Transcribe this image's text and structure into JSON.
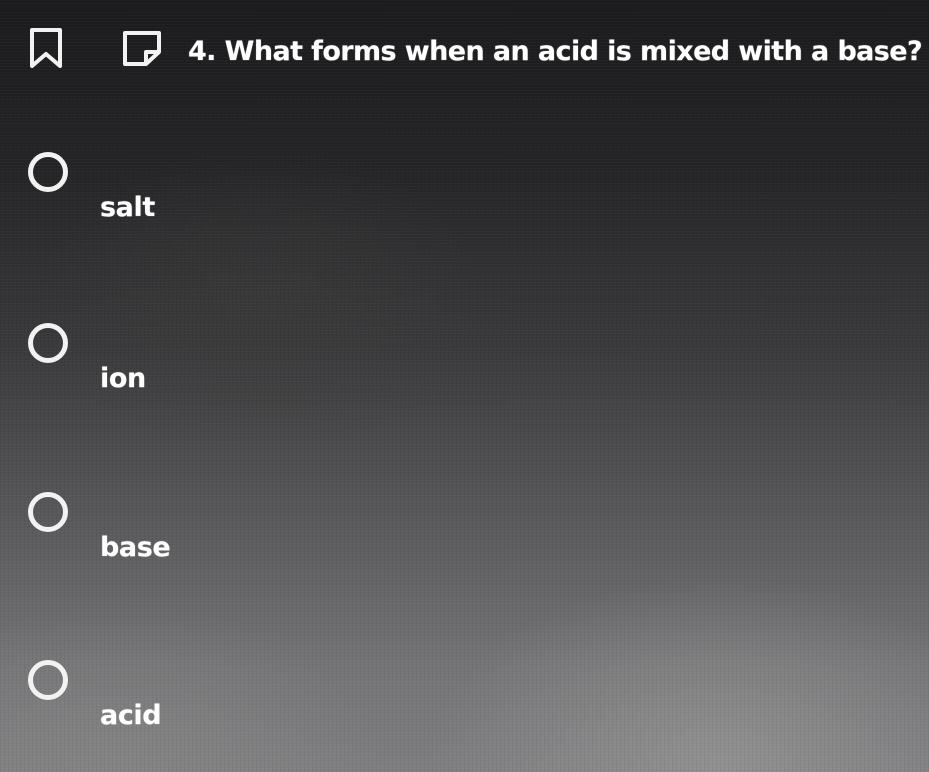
{
  "question": {
    "text": "4. What forms when an acid is mixed with a base?"
  },
  "toolbar": {
    "bookmark_icon": "bookmark-icon",
    "flag_icon": "flag-icon"
  },
  "options": [
    {
      "label": "salt",
      "selected": false
    },
    {
      "label": "ion",
      "selected": false
    },
    {
      "label": "base",
      "selected": false
    },
    {
      "label": "acid",
      "selected": false
    }
  ],
  "colors": {
    "text": "#ffffff",
    "radio_border": "#f2f2f2",
    "background_top": "#1b1b1d",
    "background_bottom": "#7e7e80"
  }
}
